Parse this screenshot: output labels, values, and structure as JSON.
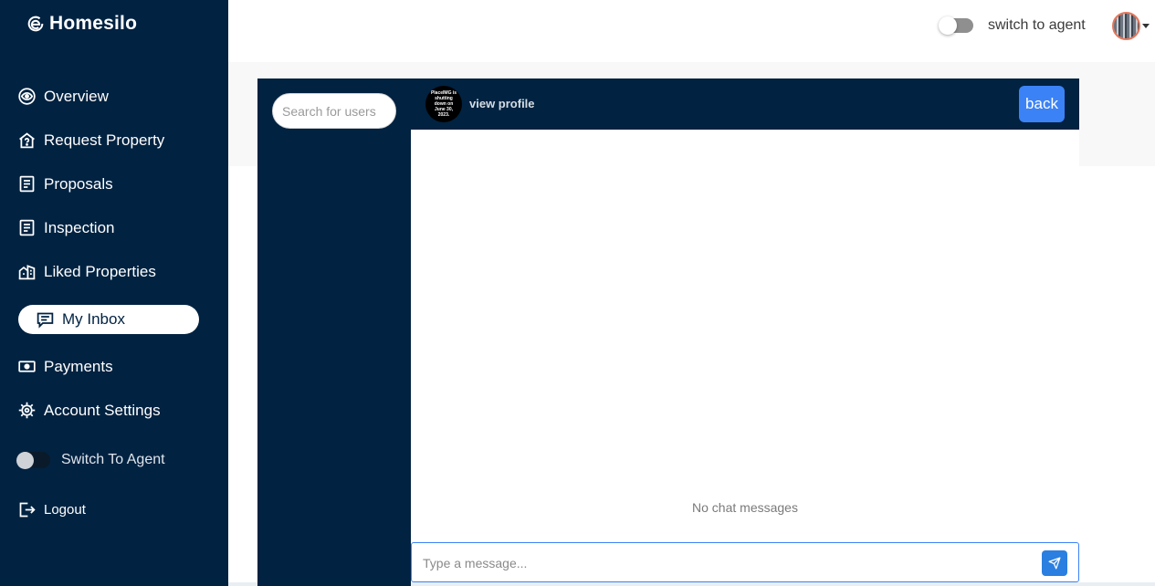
{
  "brand": {
    "name": "Homesilo"
  },
  "sidebar": {
    "items": [
      {
        "label": "Overview",
        "icon": "eye-icon"
      },
      {
        "label": "Request Property",
        "icon": "house-question-icon"
      },
      {
        "label": "Proposals",
        "icon": "document-icon"
      },
      {
        "label": "Inspection",
        "icon": "document-icon"
      },
      {
        "label": "Liked Properties",
        "icon": "buildings-icon"
      },
      {
        "label": "My Inbox",
        "icon": "chat-icon",
        "active": true
      },
      {
        "label": "Payments",
        "icon": "cash-icon"
      },
      {
        "label": "Account Settings",
        "icon": "gear-icon"
      }
    ],
    "toggle_label": "Switch To Agent",
    "logout_label": "Logout"
  },
  "topbar": {
    "toggle_label": "switch to agent"
  },
  "chat": {
    "search_placeholder": "Search for users",
    "contact_avatar_text": "PlaceIMG is shutting down on June 30, 2023.",
    "view_profile_label": "view profile",
    "back_label": "back",
    "empty_text": "No chat messages",
    "message_placeholder": "Type a message..."
  },
  "colors": {
    "sidebar_bg": "#012241",
    "accent_blue": "#3b82f6",
    "send_blue": "#2a7fe0"
  }
}
